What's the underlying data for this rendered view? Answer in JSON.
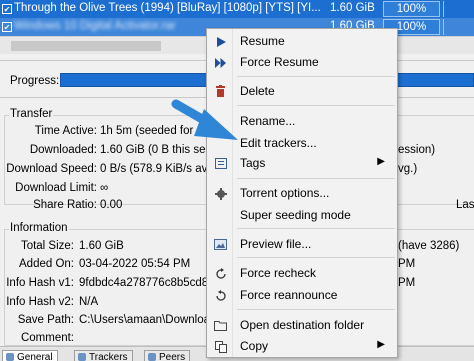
{
  "torrents": [
    {
      "check": "✔",
      "name": "Through the Olive Trees (1994) [BluRay] [1080p] [YTS] [YI...",
      "size": "1.60 GiB",
      "progress": "100%"
    },
    {
      "check": "✔",
      "name": "Windows 10 Digital Activator.rar",
      "size": "1.60 GiB",
      "progress": "100%"
    }
  ],
  "general": {
    "progress_label": "Progress:",
    "transfer": {
      "title": "Transfer",
      "fields": [
        {
          "label": "Time Active:",
          "value": "1h 5m (seeded for 17m"
        },
        {
          "label": "Downloaded:",
          "value": "1.60 GiB (0 B this sessio"
        },
        {
          "label": "Download Speed:",
          "value": "0 B/s (578.9 KiB/s avg.)"
        },
        {
          "label": "Download Limit:",
          "value": "∞"
        },
        {
          "label": "Share Ratio:",
          "value": "0.00"
        }
      ],
      "right_clips": [
        "ession)",
        "vg.)"
      ],
      "far_right_clip": "Las"
    },
    "information": {
      "title": "Information",
      "fields": [
        {
          "label": "Total Size:",
          "value": "1.60 GiB"
        },
        {
          "label": "Added On:",
          "value": "03-04-2022 05:54 PM"
        },
        {
          "label": "Info Hash v1:",
          "value": "9fdbdc4a278776c8b5cd8"
        },
        {
          "label": "Info Hash v2:",
          "value": "N/A"
        },
        {
          "label": "Save Path:",
          "value": "C:\\Users\\amaan\\Downloads"
        },
        {
          "label": "Comment:",
          "value": ""
        }
      ],
      "right_clips": [
        "(have 3286)",
        "PM",
        "PM"
      ]
    }
  },
  "tabs": [
    {
      "label": "General"
    },
    {
      "label": "Trackers"
    },
    {
      "label": "Peers"
    }
  ],
  "context_menu": {
    "items": [
      {
        "label": "Resume",
        "icon": "play-icon"
      },
      {
        "label": "Force Resume",
        "icon": "fast-forward-icon"
      },
      {
        "label": "Delete",
        "icon": "trash-icon"
      },
      {
        "label": "Rename...",
        "icon": ""
      },
      {
        "label": "Edit trackers...",
        "icon": ""
      },
      {
        "label": "Tags",
        "icon": "tag-icon",
        "submenu": "▶"
      },
      {
        "label": "Torrent options...",
        "icon": "gear-icon"
      },
      {
        "label": "Super seeding mode",
        "icon": ""
      },
      {
        "label": "Preview file...",
        "icon": "image-icon"
      },
      {
        "label": "Force recheck",
        "icon": "recheck-icon"
      },
      {
        "label": "Force reannounce",
        "icon": "reannounce-icon"
      },
      {
        "label": "Open destination folder",
        "icon": "folder-icon"
      },
      {
        "label": "Copy",
        "icon": "copy-icon",
        "submenu": "▶"
      }
    ]
  },
  "colors": {
    "selection": "#1c6fd1",
    "arrow": "#2f86d6",
    "menu_bg": "#f2f2f2"
  }
}
